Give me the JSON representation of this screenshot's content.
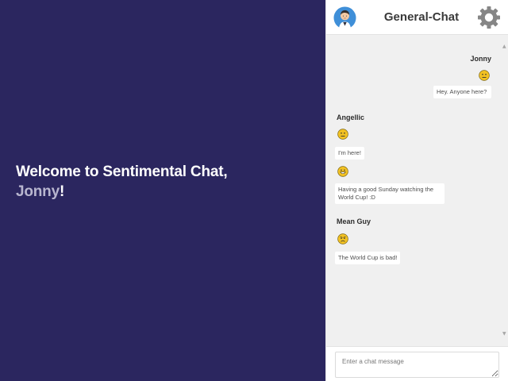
{
  "welcome": {
    "prefix": "Welcome to Sentimental Chat,",
    "username": "Jonny",
    "suffix": "!"
  },
  "header": {
    "room_title": "General-Chat",
    "avatar_icon": "user-avatar-icon",
    "settings_icon": "gear-icon"
  },
  "messages": [
    {
      "sender": "Jonny",
      "align": "right",
      "items": [
        {
          "sentiment": "neutral",
          "text": "Hey. Anyone here?"
        }
      ]
    },
    {
      "sender": "Angellic",
      "align": "left",
      "items": [
        {
          "sentiment": "neutral",
          "text": "I'm here!"
        },
        {
          "sentiment": "happy",
          "text": "Having a good Sunday watching the World Cup! :D"
        }
      ]
    },
    {
      "sender": "Mean Guy",
      "align": "left",
      "items": [
        {
          "sentiment": "angry",
          "text": "The World Cup is bad!"
        }
      ]
    }
  ],
  "composer": {
    "placeholder": "Enter a chat message"
  },
  "colors": {
    "left_panel_bg": "#2b265f",
    "chat_bg": "#f0f0f0",
    "emoji_yellow": "#f2c122"
  }
}
